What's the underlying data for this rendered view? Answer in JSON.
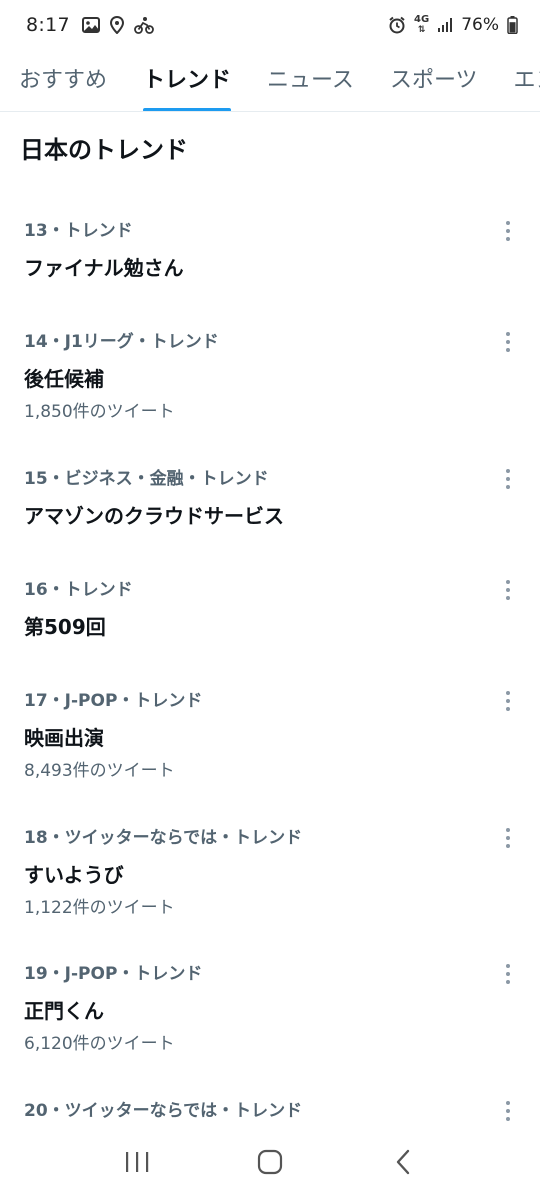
{
  "status_bar": {
    "time": "8:17",
    "left_icons": [
      "image-icon",
      "location-icon",
      "cycling-icon"
    ],
    "right_icons": [
      "alarm-icon",
      "network-4g-icon",
      "signal-icon",
      "battery-icon"
    ],
    "network_label": "4G",
    "battery_percent": "76%",
    "battery_level": 0.76
  },
  "tabs": [
    {
      "label": "おすすめ",
      "active": false
    },
    {
      "label": "トレンド",
      "active": true
    },
    {
      "label": "ニュース",
      "active": false
    },
    {
      "label": "スポーツ",
      "active": false
    },
    {
      "label": "エンタメ",
      "active": false
    }
  ],
  "section_title": "日本のトレンド",
  "trends": [
    {
      "meta": "13・トレンド",
      "title": "ファイナル勉さん",
      "count": ""
    },
    {
      "meta": "14・J1リーグ・トレンド",
      "title": "後任候補",
      "count": "1,850件のツイート"
    },
    {
      "meta": "15・ビジネス・金融・トレンド",
      "title": "アマゾンのクラウドサービス",
      "count": ""
    },
    {
      "meta": "16・トレンド",
      "title": "第509回",
      "count": ""
    },
    {
      "meta": "17・J-POP・トレンド",
      "title": "映画出演",
      "count": "8,493件のツイート"
    },
    {
      "meta": "18・ツイッターならでは・トレンド",
      "title": "すいようび",
      "count": "1,122件のツイート"
    },
    {
      "meta": "19・J-POP・トレンド",
      "title": "正門くん",
      "count": "6,120件のツイート"
    },
    {
      "meta": "20・ツイッターならでは・トレンド",
      "title": "",
      "count": ""
    }
  ],
  "nav": {
    "recent_icon": "recent-apps-icon",
    "home_icon": "home-icon",
    "back_icon": "back-icon"
  },
  "colors": {
    "accent": "#1d9bf0",
    "text_primary": "#0f1419",
    "text_secondary": "#536471"
  }
}
